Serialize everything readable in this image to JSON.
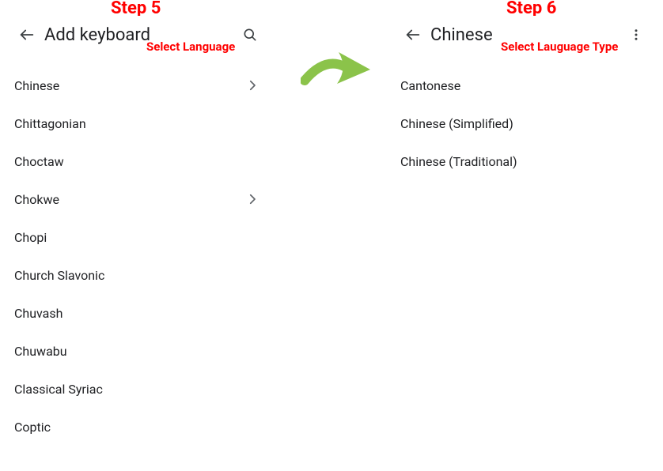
{
  "steps": {
    "left_label": "Step 5",
    "right_label": "Step 6"
  },
  "left_panel": {
    "title": "Add keyboard",
    "annotation": "Select Language",
    "items": [
      {
        "label": "Chinese",
        "has_chevron": true
      },
      {
        "label": "Chittagonian",
        "has_chevron": false
      },
      {
        "label": "Choctaw",
        "has_chevron": false
      },
      {
        "label": "Chokwe",
        "has_chevron": true
      },
      {
        "label": "Chopi",
        "has_chevron": false
      },
      {
        "label": "Church Slavonic",
        "has_chevron": false
      },
      {
        "label": "Chuvash",
        "has_chevron": false
      },
      {
        "label": "Chuwabu",
        "has_chevron": false
      },
      {
        "label": "Classical Syriac",
        "has_chevron": false
      },
      {
        "label": "Coptic",
        "has_chevron": false
      }
    ]
  },
  "right_panel": {
    "title": "Chinese",
    "annotation": "Select Lauguage Type",
    "items": [
      {
        "label": "Cantonese"
      },
      {
        "label": "Chinese (Simplified)"
      },
      {
        "label": "Chinese (Traditional)"
      }
    ]
  },
  "colors": {
    "accent_red": "#ff0000",
    "arrow_green": "#8bc34a"
  }
}
